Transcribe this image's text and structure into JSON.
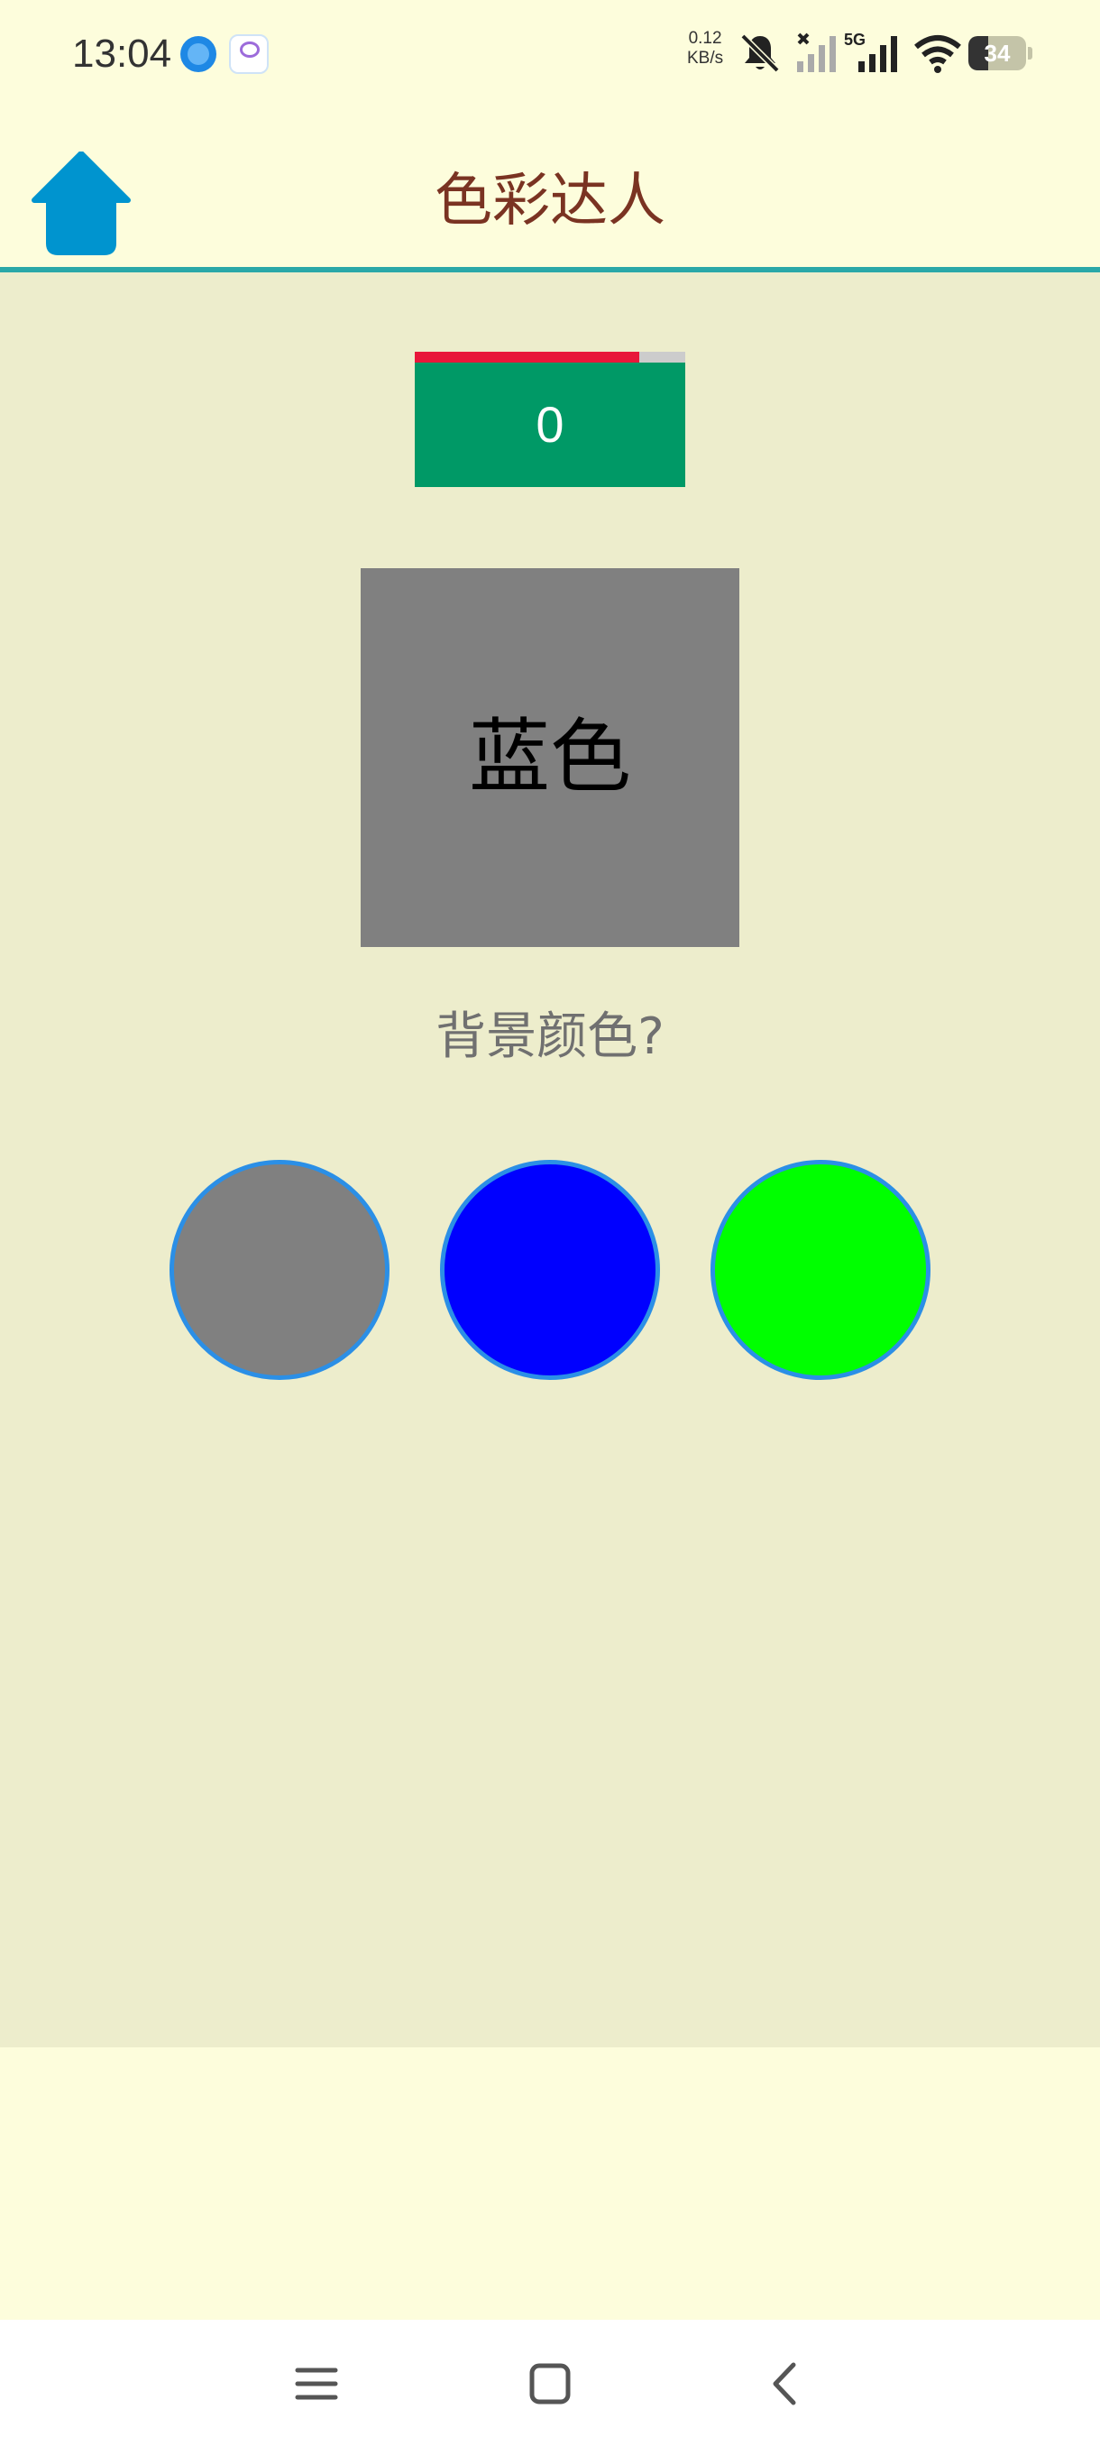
{
  "status_bar": {
    "time": "13:04",
    "net_speed_value": "0.12",
    "net_speed_unit": "KB/s",
    "network_label": "5G",
    "battery_level": "34",
    "battery_fraction": 0.34,
    "icons": [
      "browser-icon",
      "app-notification-icon",
      "mute-icon",
      "signal-icon",
      "signal-icon",
      "wifi-icon",
      "battery-icon"
    ]
  },
  "header": {
    "title": "色彩达人",
    "title_color": "#7A3322",
    "home_icon": "home-icon",
    "home_icon_color": "#0094CF",
    "divider_color": "#2AA8A8"
  },
  "game": {
    "timer_fraction": 0.83,
    "timer_color": "#E8173A",
    "score": "0",
    "score_bg": "#009966",
    "card": {
      "word": "蓝色",
      "background_color": "#808080",
      "text_color": "#000000"
    },
    "question": "背景颜色?",
    "options": [
      {
        "color": "#808080"
      },
      {
        "color": "#0000FF"
      },
      {
        "color": "#00FF00"
      }
    ],
    "option_border_color": "#2B8FE6"
  },
  "nav_bar": {
    "icons": [
      "menu-icon",
      "home-square-icon",
      "back-icon"
    ]
  }
}
